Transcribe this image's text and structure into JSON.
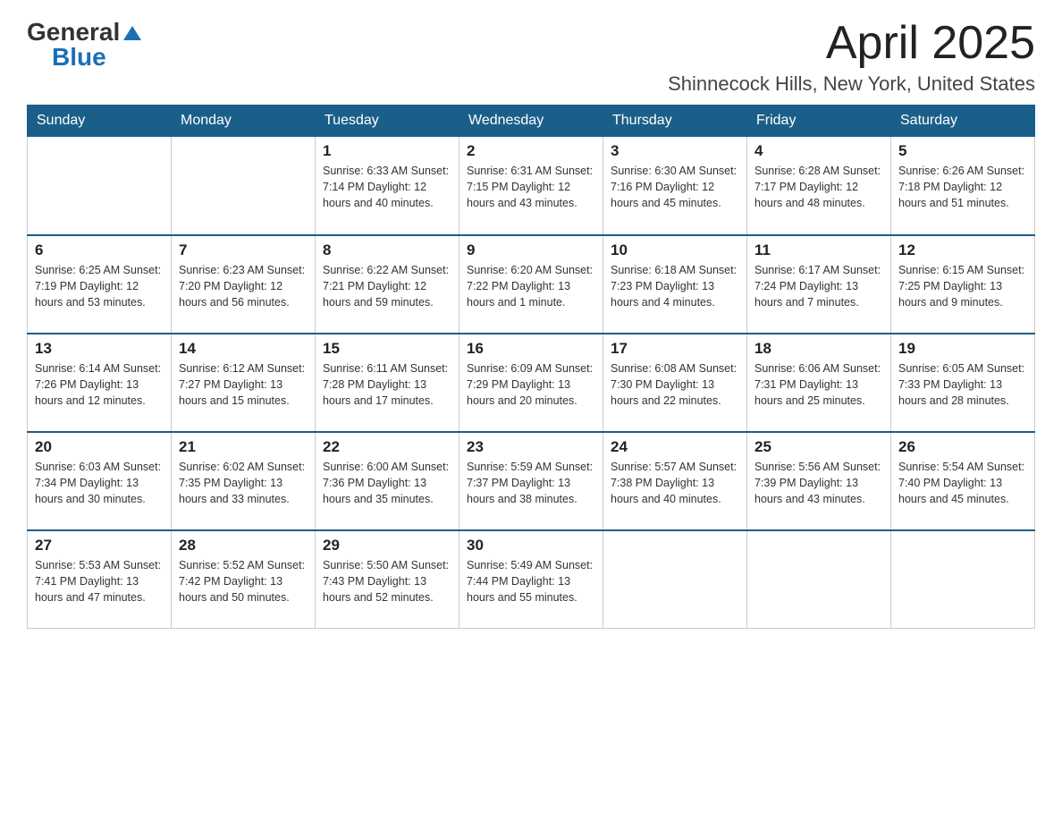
{
  "header": {
    "logo_general": "General",
    "logo_blue": "Blue",
    "month_title": "April 2025",
    "location": "Shinnecock Hills, New York, United States"
  },
  "days_of_week": [
    "Sunday",
    "Monday",
    "Tuesday",
    "Wednesday",
    "Thursday",
    "Friday",
    "Saturday"
  ],
  "weeks": [
    [
      {
        "day": "",
        "info": ""
      },
      {
        "day": "",
        "info": ""
      },
      {
        "day": "1",
        "info": "Sunrise: 6:33 AM\nSunset: 7:14 PM\nDaylight: 12 hours\nand 40 minutes."
      },
      {
        "day": "2",
        "info": "Sunrise: 6:31 AM\nSunset: 7:15 PM\nDaylight: 12 hours\nand 43 minutes."
      },
      {
        "day": "3",
        "info": "Sunrise: 6:30 AM\nSunset: 7:16 PM\nDaylight: 12 hours\nand 45 minutes."
      },
      {
        "day": "4",
        "info": "Sunrise: 6:28 AM\nSunset: 7:17 PM\nDaylight: 12 hours\nand 48 minutes."
      },
      {
        "day": "5",
        "info": "Sunrise: 6:26 AM\nSunset: 7:18 PM\nDaylight: 12 hours\nand 51 minutes."
      }
    ],
    [
      {
        "day": "6",
        "info": "Sunrise: 6:25 AM\nSunset: 7:19 PM\nDaylight: 12 hours\nand 53 minutes."
      },
      {
        "day": "7",
        "info": "Sunrise: 6:23 AM\nSunset: 7:20 PM\nDaylight: 12 hours\nand 56 minutes."
      },
      {
        "day": "8",
        "info": "Sunrise: 6:22 AM\nSunset: 7:21 PM\nDaylight: 12 hours\nand 59 minutes."
      },
      {
        "day": "9",
        "info": "Sunrise: 6:20 AM\nSunset: 7:22 PM\nDaylight: 13 hours\nand 1 minute."
      },
      {
        "day": "10",
        "info": "Sunrise: 6:18 AM\nSunset: 7:23 PM\nDaylight: 13 hours\nand 4 minutes."
      },
      {
        "day": "11",
        "info": "Sunrise: 6:17 AM\nSunset: 7:24 PM\nDaylight: 13 hours\nand 7 minutes."
      },
      {
        "day": "12",
        "info": "Sunrise: 6:15 AM\nSunset: 7:25 PM\nDaylight: 13 hours\nand 9 minutes."
      }
    ],
    [
      {
        "day": "13",
        "info": "Sunrise: 6:14 AM\nSunset: 7:26 PM\nDaylight: 13 hours\nand 12 minutes."
      },
      {
        "day": "14",
        "info": "Sunrise: 6:12 AM\nSunset: 7:27 PM\nDaylight: 13 hours\nand 15 minutes."
      },
      {
        "day": "15",
        "info": "Sunrise: 6:11 AM\nSunset: 7:28 PM\nDaylight: 13 hours\nand 17 minutes."
      },
      {
        "day": "16",
        "info": "Sunrise: 6:09 AM\nSunset: 7:29 PM\nDaylight: 13 hours\nand 20 minutes."
      },
      {
        "day": "17",
        "info": "Sunrise: 6:08 AM\nSunset: 7:30 PM\nDaylight: 13 hours\nand 22 minutes."
      },
      {
        "day": "18",
        "info": "Sunrise: 6:06 AM\nSunset: 7:31 PM\nDaylight: 13 hours\nand 25 minutes."
      },
      {
        "day": "19",
        "info": "Sunrise: 6:05 AM\nSunset: 7:33 PM\nDaylight: 13 hours\nand 28 minutes."
      }
    ],
    [
      {
        "day": "20",
        "info": "Sunrise: 6:03 AM\nSunset: 7:34 PM\nDaylight: 13 hours\nand 30 minutes."
      },
      {
        "day": "21",
        "info": "Sunrise: 6:02 AM\nSunset: 7:35 PM\nDaylight: 13 hours\nand 33 minutes."
      },
      {
        "day": "22",
        "info": "Sunrise: 6:00 AM\nSunset: 7:36 PM\nDaylight: 13 hours\nand 35 minutes."
      },
      {
        "day": "23",
        "info": "Sunrise: 5:59 AM\nSunset: 7:37 PM\nDaylight: 13 hours\nand 38 minutes."
      },
      {
        "day": "24",
        "info": "Sunrise: 5:57 AM\nSunset: 7:38 PM\nDaylight: 13 hours\nand 40 minutes."
      },
      {
        "day": "25",
        "info": "Sunrise: 5:56 AM\nSunset: 7:39 PM\nDaylight: 13 hours\nand 43 minutes."
      },
      {
        "day": "26",
        "info": "Sunrise: 5:54 AM\nSunset: 7:40 PM\nDaylight: 13 hours\nand 45 minutes."
      }
    ],
    [
      {
        "day": "27",
        "info": "Sunrise: 5:53 AM\nSunset: 7:41 PM\nDaylight: 13 hours\nand 47 minutes."
      },
      {
        "day": "28",
        "info": "Sunrise: 5:52 AM\nSunset: 7:42 PM\nDaylight: 13 hours\nand 50 minutes."
      },
      {
        "day": "29",
        "info": "Sunrise: 5:50 AM\nSunset: 7:43 PM\nDaylight: 13 hours\nand 52 minutes."
      },
      {
        "day": "30",
        "info": "Sunrise: 5:49 AM\nSunset: 7:44 PM\nDaylight: 13 hours\nand 55 minutes."
      },
      {
        "day": "",
        "info": ""
      },
      {
        "day": "",
        "info": ""
      },
      {
        "day": "",
        "info": ""
      }
    ]
  ]
}
